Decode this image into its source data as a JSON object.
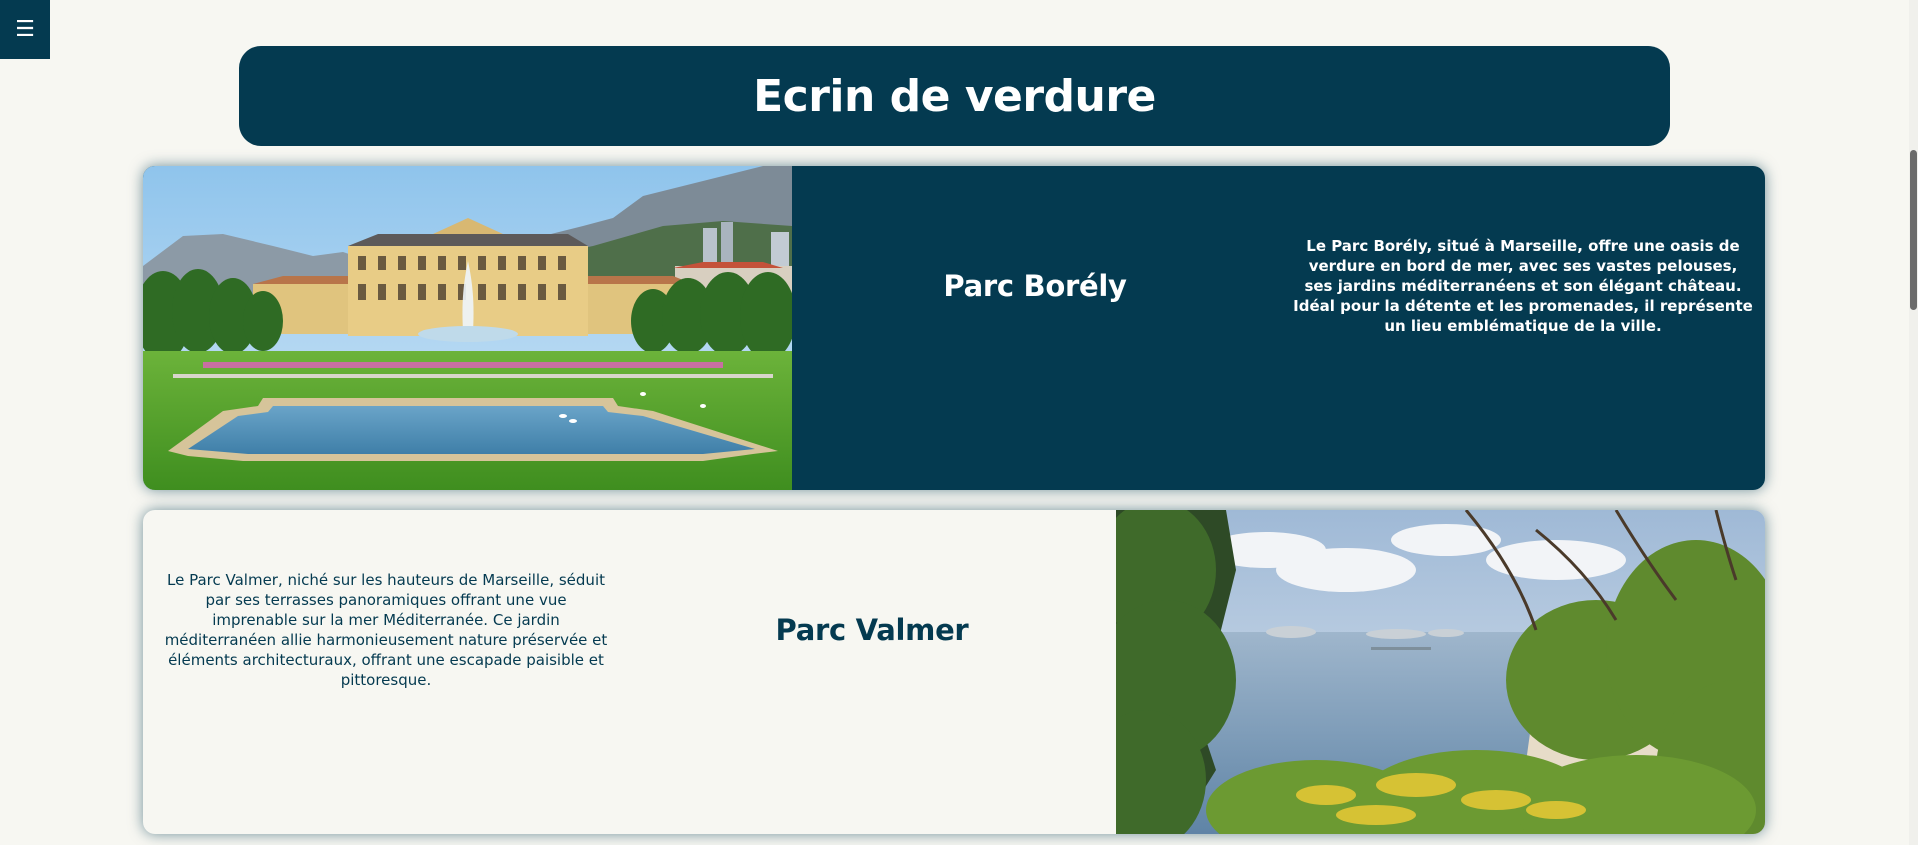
{
  "menu": {
    "icon": "hamburger-menu-icon",
    "glyph": "☰"
  },
  "header": {
    "title": "Ecrin de verdure"
  },
  "parks": [
    {
      "name": "Parc Borély",
      "description": "Le Parc Borély, situé à Marseille, offre une oasis de verdure en bord de mer, avec ses vastes pelouses, ses jardins méditerranéens et son élégant château. Idéal pour la détente et les promenades, il représente un lieu emblématique de la ville."
    },
    {
      "name": "Parc Valmer",
      "description": "Le Parc Valmer, niché sur les hauteurs de Marseille, séduit par ses terrasses panoramiques offrant une vue imprenable sur la mer Méditerranée. Ce jardin méditerranéen allie harmonieusement nature préservée et éléments architecturaux, offrant une escapade paisible et pittoresque."
    }
  ],
  "colors": {
    "brand": "#043a50",
    "background": "#f7f7f2",
    "text_light": "#ffffff"
  }
}
